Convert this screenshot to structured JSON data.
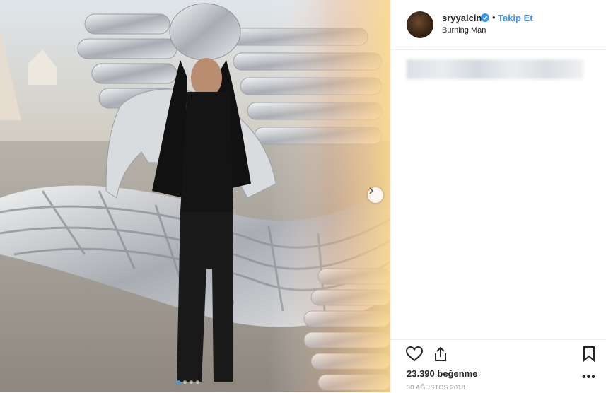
{
  "post": {
    "username": "sryyalcin",
    "separator": "•",
    "follow_label": "Takip Et",
    "location": "Burning Man",
    "likes_text": "23.390 beğenme",
    "date_text": "30 AĞUSTOS 2018",
    "more_label": "•••"
  },
  "carousel": {
    "slide_count": 4,
    "active_index": 0
  },
  "colors": {
    "accent": "#3897f0",
    "text": "#262626",
    "muted": "#999999"
  },
  "icons": {
    "verified": "verified-badge-icon",
    "like": "heart-icon",
    "share": "share-icon",
    "save": "bookmark-icon",
    "next": "chevron-right-icon"
  }
}
